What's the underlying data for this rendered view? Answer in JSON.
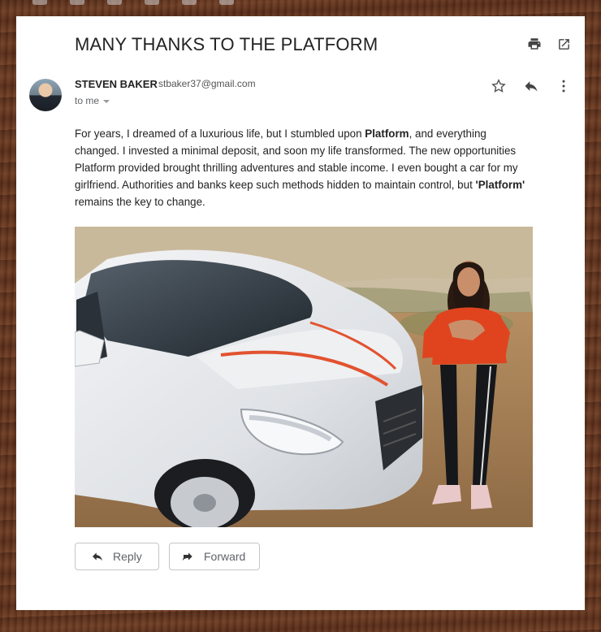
{
  "email": {
    "subject": "MANY THANKS TO THE PLATFORM",
    "sender": {
      "name": "STEVEN BAKER",
      "email": "stbaker37@gmail.com",
      "recipient_label": "to me"
    },
    "body": {
      "p1_a": "For years, I dreamed of a luxurious life, but I stumbled upon ",
      "p1_bold": "Platform",
      "p1_b": ", and everything changed. I invested a minimal deposit, and soon my life transformed. The new opportunities Platform provided brought thrilling adventures and stable income. I even bought a car for my girlfriend. Authorities and banks keep such methods hidden to maintain control, but ",
      "p1_bold2": "'Platform'",
      "p1_c": " remains the key to change."
    },
    "actions": {
      "reply_label": "Reply",
      "forward_label": "Forward"
    },
    "icons": {
      "print": "print-icon",
      "open_new_window": "open-in-new-icon",
      "star": "star-icon",
      "reply": "reply-icon",
      "more": "more-vert-icon"
    }
  },
  "colors": {
    "card_background": "#ffffff",
    "text_primary": "#222222",
    "text_secondary": "#5f6368",
    "wood_background": "#6b3a22",
    "car_stripe": "#e2522f",
    "top_red": "#e0441f"
  }
}
